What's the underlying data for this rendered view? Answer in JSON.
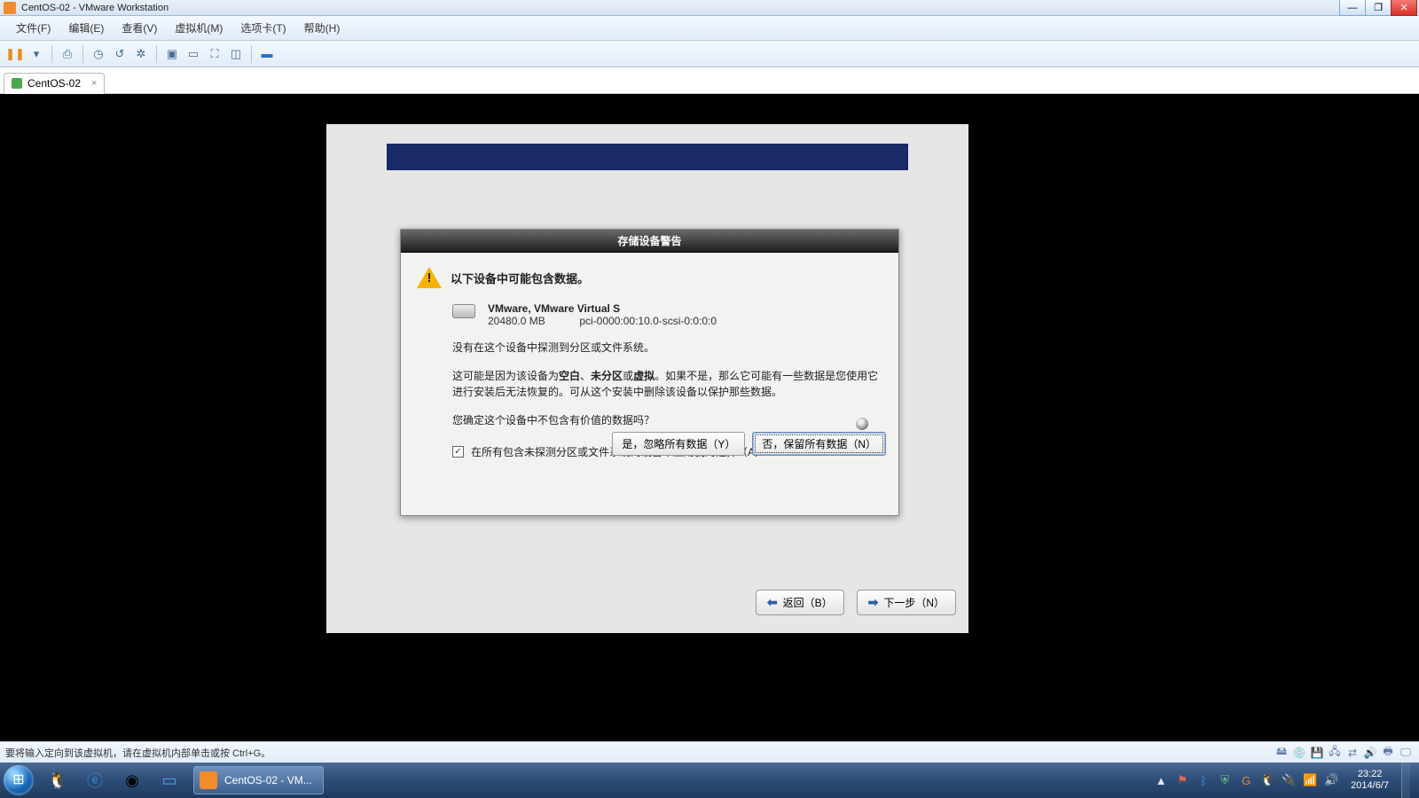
{
  "window": {
    "title": "CentOS-02 - VMware Workstation",
    "min_glyph": "—",
    "max_glyph": "❐",
    "close_glyph": "✕"
  },
  "menu": {
    "items": [
      "文件(F)",
      "编辑(E)",
      "查看(V)",
      "虚拟机(M)",
      "选项卡(T)",
      "帮助(H)"
    ]
  },
  "toolbar": {
    "groups": [
      [
        "library-icon",
        "power-dropdown-icon"
      ],
      [
        "snapshot-take-icon"
      ],
      [
        "snapshot-manager-icon",
        "revert-icon",
        "suspend-icon"
      ],
      [
        "screen-fit-icon",
        "screen-stretch-icon",
        "fullscreen-icon",
        "unity-icon"
      ],
      [
        "console-icon"
      ]
    ]
  },
  "tab": {
    "label": "CentOS-02",
    "close": "×"
  },
  "dialog": {
    "title": "存储设备警告",
    "heading": "以下设备中可能包含数据。",
    "device_name": "VMware, VMware Virtual S",
    "device_size": "20480.0 MB",
    "device_path": "pci-0000:00:10.0-scsi-0:0:0:0",
    "body1": "没有在这个设备中探测到分区或文件系统。",
    "body2_pre": "这可能是因为该设备为",
    "body2_b1": "空白",
    "body2_sep1": "、",
    "body2_b2": "未分区",
    "body2_sep2": "或",
    "body2_b3": "虚拟",
    "body2_post": "。如果不是，那么它可能有一些数据是您使用它进行安装后无法恢复的。可从这个安装中删除该设备以保护那些数据。",
    "body3": "您确定这个设备中不包含有价值的数据吗？",
    "checkbox_label": "在所有包含未探测分区或文件系统的设备中应用我的选择（A）",
    "checkbox_checked": "✓",
    "yes_button": "是，忽略所有数据（Y）",
    "no_button": "否，保留所有数据（N）"
  },
  "wizard": {
    "back": "返回（B）",
    "next": "下一步（N）"
  },
  "vmware_status": {
    "hint": "要将输入定向到该虚拟机，请在虚拟机内部单击或按 Ctrl+G。"
  },
  "taskbar": {
    "active_task": "CentOS-02 - VM...",
    "tray_show_hidden": "▲",
    "clock_time": "23:22",
    "clock_date": "2014/6/7"
  }
}
